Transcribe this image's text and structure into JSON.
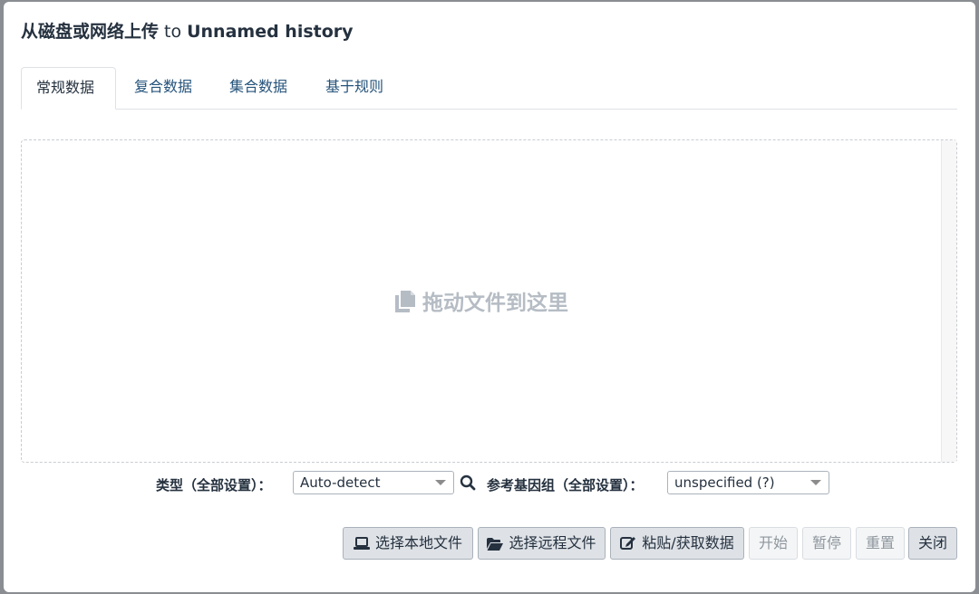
{
  "modal": {
    "title_prefix": "从磁盘或网络上传",
    "title_to": "to",
    "history_name": "Unnamed history"
  },
  "tabs": [
    {
      "label": "常规数据",
      "active": true
    },
    {
      "label": "复合数据",
      "active": false
    },
    {
      "label": "集合数据",
      "active": false
    },
    {
      "label": "基于规则",
      "active": false
    }
  ],
  "dropzone": {
    "hint": "拖动文件到这里",
    "icon": "copy-icon"
  },
  "settings": {
    "type_label": "类型（全部设置）：",
    "type_value": "Auto-detect",
    "genome_label": "参考基因组（全部设置）：",
    "genome_value": "unspecified (?)"
  },
  "buttons": {
    "local_file": "选择本地文件",
    "remote_file": "选择远程文件",
    "paste_fetch": "粘贴/获取数据",
    "start": "开始",
    "pause": "暂停",
    "reset": "重置",
    "close": "关闭"
  },
  "colors": {
    "tab_link": "#25537b",
    "text": "#25313f",
    "hint": "#b5bcc4",
    "button_bg": "#dee2e6"
  }
}
